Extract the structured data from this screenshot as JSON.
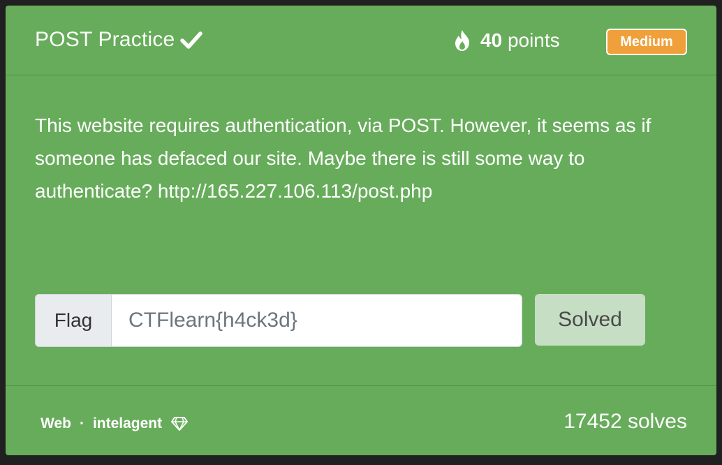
{
  "challenge": {
    "title": "POST Practice",
    "points_value": "40",
    "points_label": "points",
    "difficulty": "Medium",
    "description": "This website requires authentication, via POST. However, it seems as if someone has defaced our site. Maybe there is still some way to authenticate? http://165.227.106.113/post.php"
  },
  "flag_form": {
    "label": "Flag",
    "value": "CTFlearn{h4ck3d}",
    "submit_label": "Solved"
  },
  "footer": {
    "category": "Web",
    "separator": "·",
    "author": "intelagent",
    "solves": "17452 solves"
  },
  "icons": {
    "title_status": "check-icon",
    "points": "fire-icon",
    "author_badge": "diamond-icon"
  },
  "colors": {
    "card_bg": "#67ac5b",
    "badge_bg": "#f0a03a",
    "solved_button_bg": "#c5dec4"
  }
}
